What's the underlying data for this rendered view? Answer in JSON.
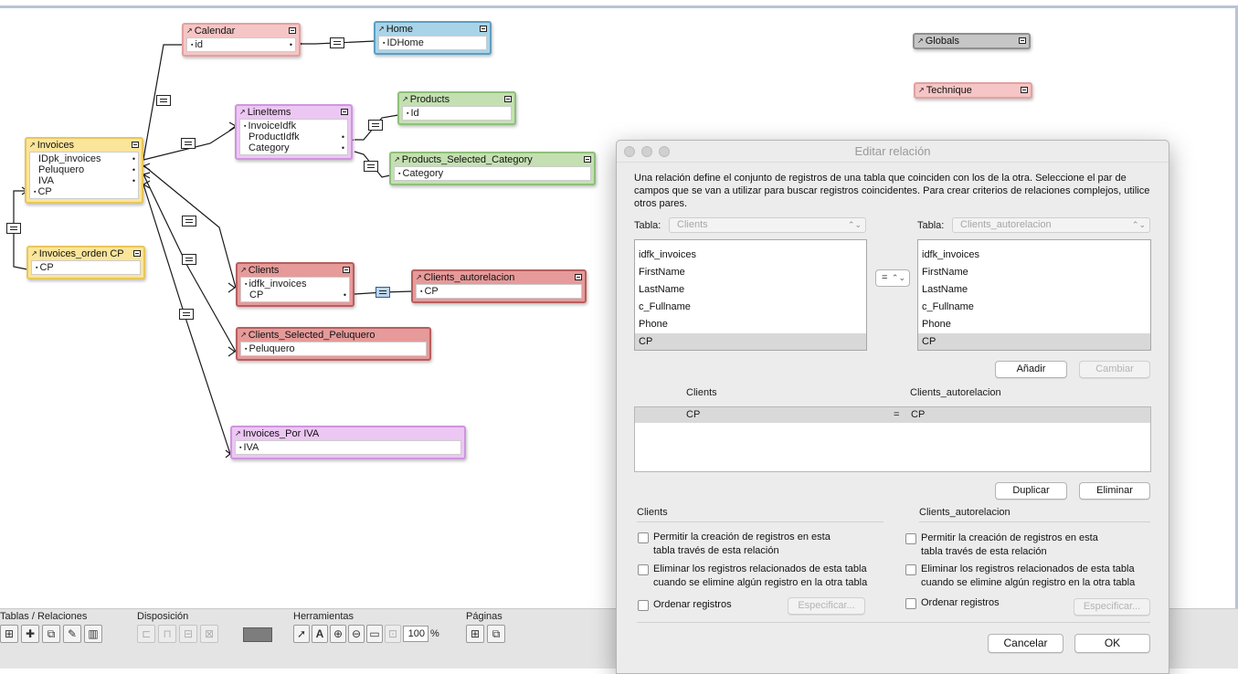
{
  "canvas": {
    "tables": [
      {
        "key": "calendar",
        "title": "Calendar",
        "fields": [
          "id"
        ]
      },
      {
        "key": "home",
        "title": "Home",
        "fields": [
          "IDHome"
        ]
      },
      {
        "key": "globals",
        "title": "Globals",
        "fields": []
      },
      {
        "key": "technique",
        "title": "Technique",
        "fields": []
      },
      {
        "key": "lineitems",
        "title": "LineItems",
        "fields": [
          "InvoiceIdfk",
          "ProductIdfk",
          "Category"
        ]
      },
      {
        "key": "products",
        "title": "Products",
        "fields": [
          "Id"
        ]
      },
      {
        "key": "products_sel",
        "title": "Products_Selected_Category",
        "fields": [
          "Category"
        ]
      },
      {
        "key": "invoices",
        "title": "Invoices",
        "fields": [
          "IDpk_invoices",
          "Peluquero",
          "IVA",
          "CP"
        ]
      },
      {
        "key": "invoices_orden",
        "title": "Invoices_orden CP",
        "fields": [
          "CP"
        ]
      },
      {
        "key": "clients",
        "title": "Clients",
        "fields": [
          "idfk_invoices",
          "CP"
        ]
      },
      {
        "key": "clients_auto",
        "title": "Clients_autorelacion",
        "fields": [
          "CP"
        ]
      },
      {
        "key": "clients_pel",
        "title": "Clients_Selected_Peluquero",
        "fields": [
          "Peluquero"
        ]
      },
      {
        "key": "invoices_iva",
        "title": "Invoices_Por IVA",
        "fields": [
          "IVA"
        ]
      }
    ]
  },
  "colors": {
    "yellow": "#fbe59a",
    "yellow_border": "#e9c659",
    "pink": "#f6c5c5",
    "pink_border": "#e2a0a0",
    "blue": "#a9d4e8",
    "blue_border": "#5d9ec4",
    "gray": "#c6c6c6",
    "gray_border": "#8f8f8f",
    "violet": "#ecc7f3",
    "violet_border": "#cf95de",
    "green": "#c4e0b2",
    "green_border": "#8fc07a",
    "red": "#e69a9a",
    "red_border": "#b85e5e"
  },
  "toolbar": {
    "tables_label": "Tablas / Relaciones",
    "layout_label": "Disposición",
    "tools_label": "Herramientas",
    "zoom_value": "100",
    "zoom_unit": "%",
    "pages_label": "Páginas"
  },
  "dialog": {
    "title": "Editar relación",
    "description": "Una relación define el conjunto de registros de una tabla que coinciden con los de la otra. Seleccione el par de campos que se van a utilizar para buscar registros coincidentes. Para crear criterios de relaciones complejos, utilice otros pares.",
    "left_table_label": "Tabla:",
    "left_table_value": "Clients",
    "right_table_label": "Tabla:",
    "right_table_value": "Clients_autorelacion",
    "left_fields": [
      "idfk_invoices",
      "FirstName",
      "LastName",
      "c_Fullname",
      "Phone",
      "CP"
    ],
    "right_fields": [
      "idfk_invoices",
      "FirstName",
      "LastName",
      "c_Fullname",
      "Phone",
      "CP"
    ],
    "selected_field": "CP",
    "operator": "=",
    "add_button": "Añadir",
    "change_button": "Cambiar",
    "pairs_header_left": "Clients",
    "pairs_header_right": "Clients_autorelacion",
    "pair_left": "CP",
    "pair_op": "=",
    "pair_right": "CP",
    "duplicate_button": "Duplicar",
    "delete_button": "Eliminar",
    "left_options_title": "Clients",
    "right_options_title": "Clients_autorelacion",
    "opt_create_1": "Permitir la creación de registros en esta",
    "opt_create_2": "tabla través de esta relación",
    "opt_delete_1": "Eliminar los registros relacionados de esta tabla",
    "opt_delete_2": "cuando se elimine algún registro en la otra tabla",
    "opt_sort": "Ordenar registros",
    "specify_button": "Especificar...",
    "cancel_button": "Cancelar",
    "ok_button": "OK"
  }
}
